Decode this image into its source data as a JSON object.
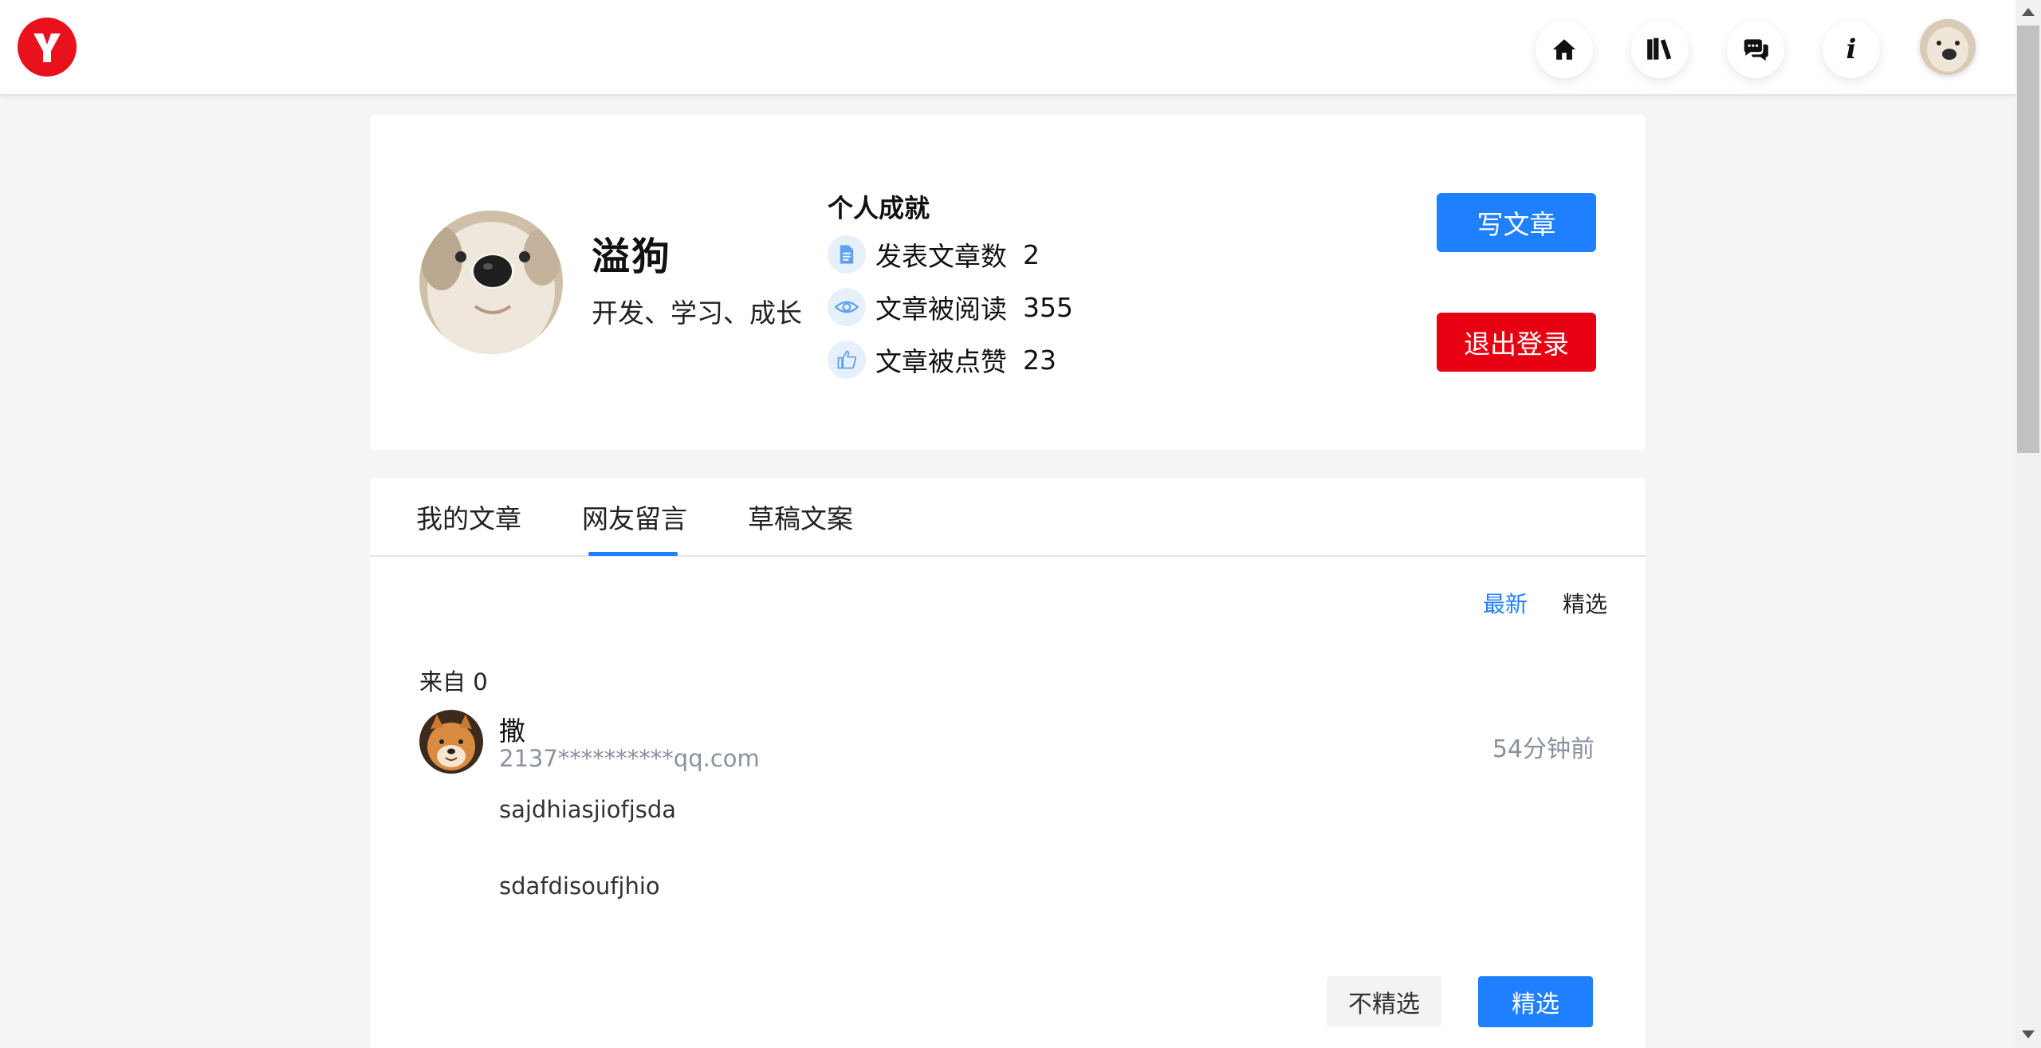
{
  "nav": {
    "logo_letter": "Y",
    "logo_color": "#e8111c",
    "buttons": [
      {
        "icon": "home-icon"
      },
      {
        "icon": "library-icon"
      },
      {
        "icon": "chat-icon"
      },
      {
        "icon": "info-icon",
        "glyph": "i"
      }
    ]
  },
  "profile": {
    "username": "溢狗",
    "motto": "开发、学习、成长",
    "achievements_title": "个人成就",
    "achievements": [
      {
        "label": "发表文章数",
        "value": "2",
        "icon": "document-icon"
      },
      {
        "label": "文章被阅读",
        "value": "355",
        "icon": "eye-icon"
      },
      {
        "label": "文章被点赞",
        "value": "23",
        "icon": "thumbs-up-icon"
      }
    ],
    "write_button": "写文章",
    "logout_button": "退出登录"
  },
  "tabs": [
    {
      "label": "我的文章"
    },
    {
      "label": "网友留言",
      "active": true
    },
    {
      "label": "草稿文案"
    }
  ],
  "sort": {
    "latest": "最新",
    "featured": "精选",
    "active": "latest"
  },
  "comment": {
    "from_label": "来自 0",
    "name": "撒",
    "email": "2137**********qq.com",
    "time": "54分钟前",
    "lines": [
      "sajdhiasjiofjsda",
      "sdafdisoufjhio"
    ],
    "unfeature_button": "不精选",
    "feature_button": "精选"
  },
  "colors": {
    "primary": "#1e80ff",
    "danger": "#e60012",
    "muted": "#8a919f"
  }
}
